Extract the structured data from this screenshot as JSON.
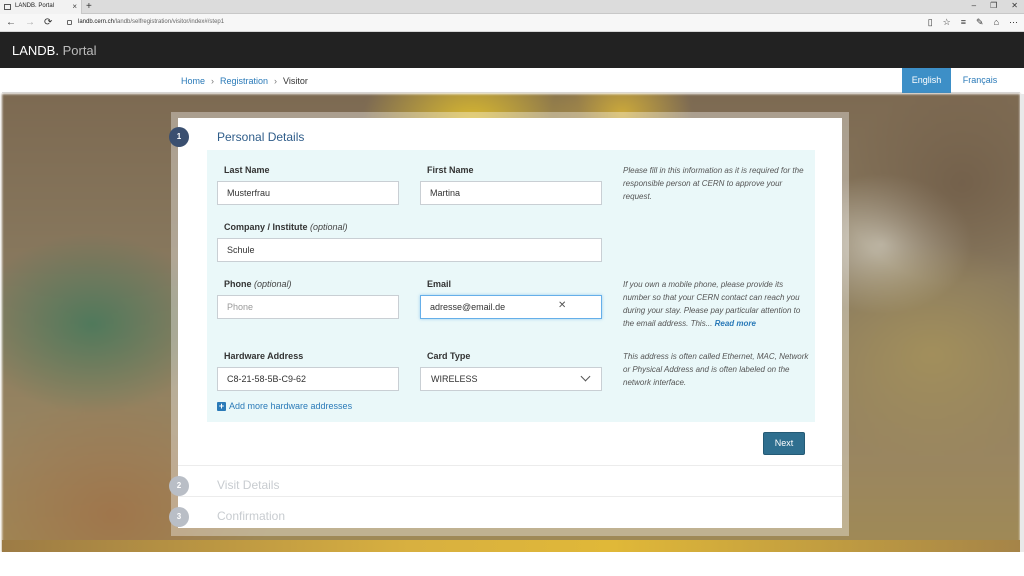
{
  "browser": {
    "tab_title": "LANDB. Portal",
    "new_tab_label": "+",
    "url_host": "landb.cern.ch",
    "url_path": "/landb/selfregistration/visitor/index#/step1",
    "window_controls": [
      "–",
      "❐",
      "✕"
    ]
  },
  "header": {
    "brand_main": "LANDB.",
    "brand_sub": "Portal"
  },
  "breadcrumb": {
    "items": [
      "Home",
      "Registration",
      "Visitor"
    ]
  },
  "languages": {
    "active": "English",
    "other": "Français"
  },
  "steps": [
    {
      "number": "1",
      "title": "Personal Details"
    },
    {
      "number": "2",
      "title": "Visit Details"
    },
    {
      "number": "3",
      "title": "Confirmation"
    }
  ],
  "form": {
    "last_name": {
      "label": "Last Name",
      "value": "Musterfrau"
    },
    "first_name": {
      "label": "First Name",
      "value": "Martina"
    },
    "company": {
      "label": "Company / Institute",
      "optional": "(optional)",
      "value": "Schule"
    },
    "phone": {
      "label": "Phone",
      "optional": "(optional)",
      "value": "",
      "placeholder": "Phone"
    },
    "email": {
      "label": "Email",
      "value": "adresse@email.de"
    },
    "hardware_address": {
      "label": "Hardware Address",
      "value": "C8-21-58-5B-C9-62"
    },
    "card_type": {
      "label": "Card Type",
      "value": "WIRELESS"
    },
    "add_more_label": "Add more hardware addresses",
    "next_label": "Next"
  },
  "help": {
    "personal": "Please fill in this information as it is required for the responsible person at CERN to approve your request.",
    "contact": "If you own a mobile phone, please provide its number so that your CERN contact can reach you during your stay. Please pay particular attention to the email address. This... ",
    "contact_read_more": "Read more",
    "hardware": "This address is often called Ethernet, MAC, Network or Physical Address and is often labeled on the network interface."
  }
}
